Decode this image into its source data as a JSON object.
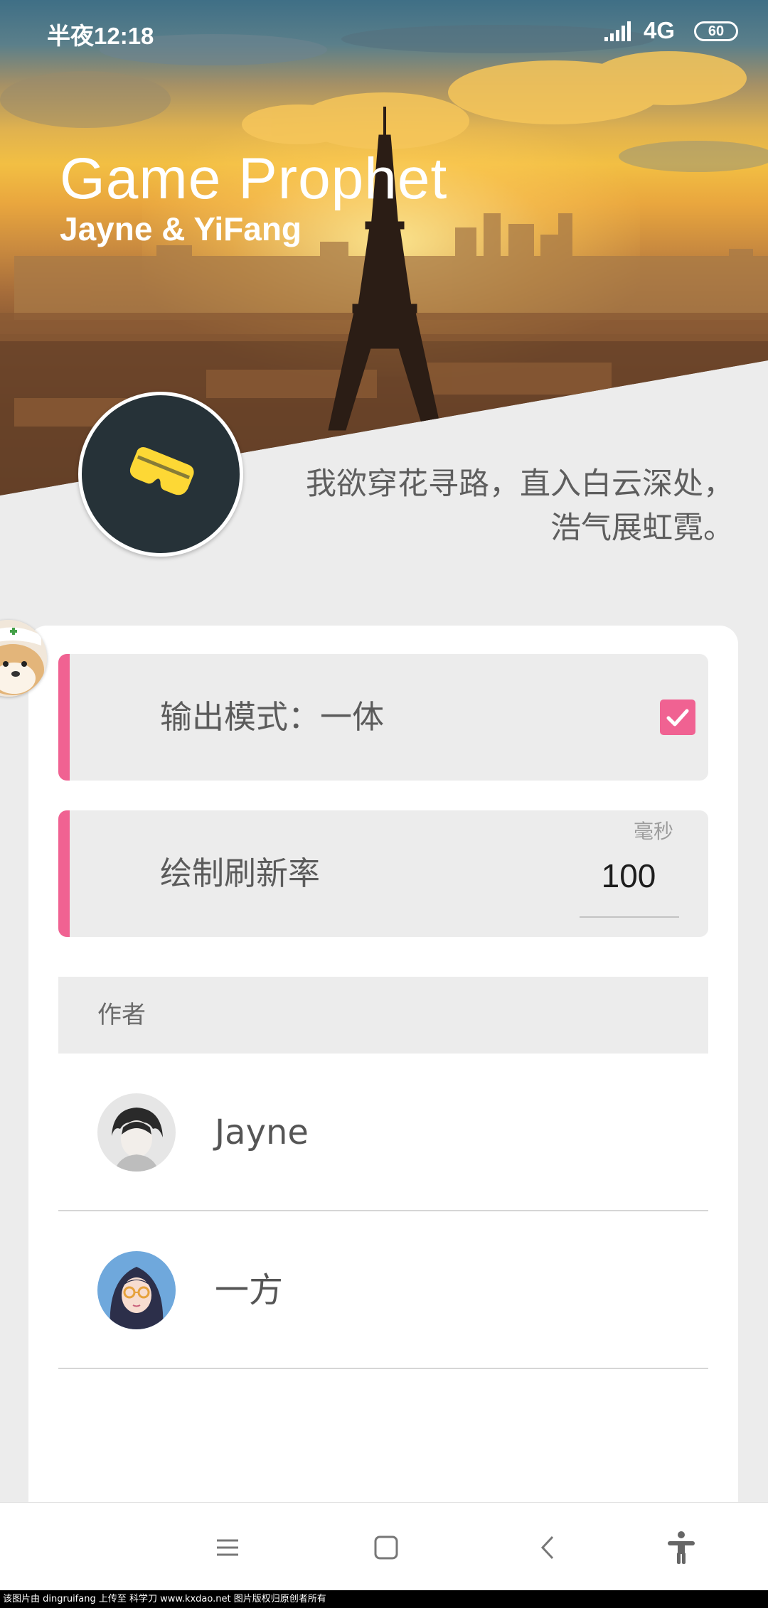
{
  "status_bar": {
    "time": "半夜12:18",
    "network": "4G",
    "battery": "60",
    "signal_icon": "signal-bars-icon",
    "battery_icon": "battery-icon"
  },
  "header": {
    "title": "Game Prophet",
    "subtitle": "Jayne & YiFang",
    "logo_icon": "vr-goggles-icon",
    "motto_line1": "我欲穿花寻路，直入白云深处，",
    "motto_line2": "浩气展虹霓。"
  },
  "settings": {
    "output_mode": {
      "label": "输出模式：一体",
      "checked": true
    },
    "refresh_rate": {
      "label": "绘制刷新率",
      "unit": "毫秒",
      "value": "100"
    }
  },
  "authors": {
    "header": "作者",
    "items": [
      {
        "name": "Jayne"
      },
      {
        "name": "一方"
      }
    ]
  },
  "nav": {
    "menu_icon": "menu-icon",
    "home_icon": "home-square-icon",
    "back_icon": "back-chevron-icon",
    "accessibility_icon": "accessibility-icon"
  },
  "watermark": "该图片由 dingruifang 上传至 科学刀 www.kxdao.net 图片版权归原创者所有",
  "colors": {
    "accent": "#f06292",
    "logo_bg": "#263238",
    "logo_fg": "#fdd835"
  }
}
